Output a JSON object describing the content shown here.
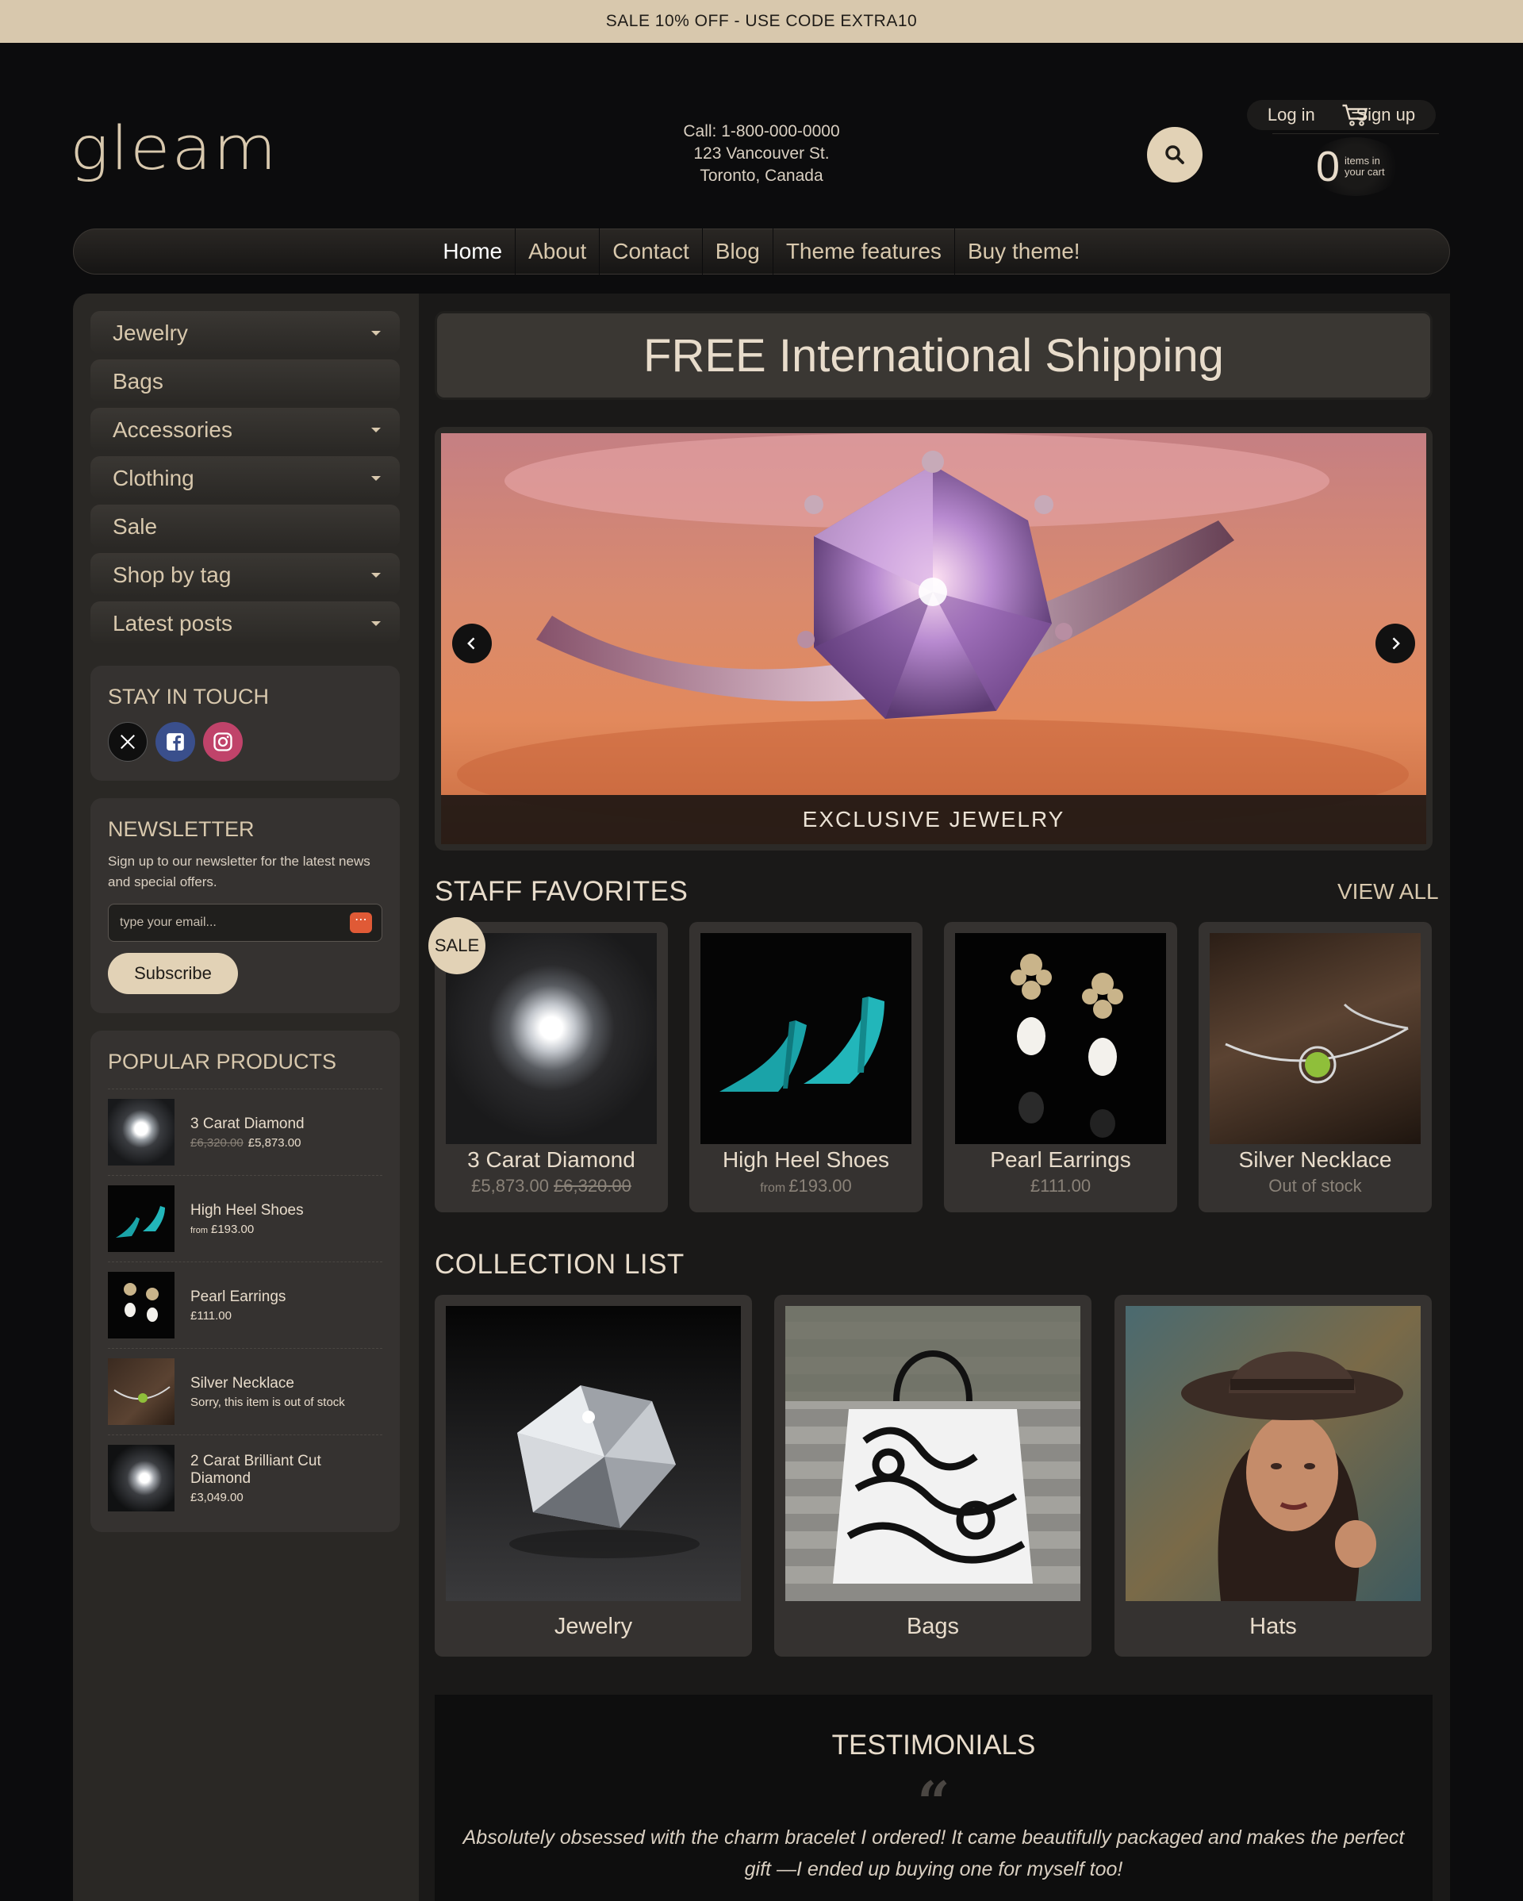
{
  "promo": {
    "text": "SALE 10% OFF - USE CODE EXTRA10"
  },
  "account": {
    "login": "Log in",
    "signup": "Sign up"
  },
  "logo": {
    "text": "gleam"
  },
  "contact": {
    "phone": "Call: 1-800-000-0000",
    "street": "123 Vancouver St.",
    "city": "Toronto, Canada"
  },
  "cart": {
    "count": "0",
    "label": "items in your cart"
  },
  "nav": {
    "items": [
      "Home",
      "About",
      "Contact",
      "Blog",
      "Theme features",
      "Buy theme!"
    ]
  },
  "sidebar": {
    "categories": [
      {
        "label": "Jewelry",
        "has_dropdown": true
      },
      {
        "label": "Bags",
        "has_dropdown": false
      },
      {
        "label": "Accessories",
        "has_dropdown": true
      },
      {
        "label": "Clothing",
        "has_dropdown": true
      },
      {
        "label": "Sale",
        "has_dropdown": false
      },
      {
        "label": "Shop by tag",
        "has_dropdown": true
      },
      {
        "label": "Latest posts",
        "has_dropdown": true
      }
    ],
    "stay_in_touch": {
      "title": "STAY IN TOUCH",
      "icons": [
        "x-icon",
        "facebook-icon",
        "instagram-icon"
      ]
    },
    "newsletter": {
      "title": "NEWSLETTER",
      "text": "Sign up to our newsletter for the latest news and special offers.",
      "placeholder": "type your email...",
      "button": "Subscribe"
    },
    "popular": {
      "title": "POPULAR PRODUCTS",
      "items": [
        {
          "name": "3 Carat Diamond",
          "old_price": "£6,320.00",
          "price": "£5,873.00",
          "from": ""
        },
        {
          "name": "High Heel Shoes",
          "old_price": "",
          "price": "£193.00",
          "from": "from"
        },
        {
          "name": "Pearl Earrings",
          "old_price": "",
          "price": "£111.00",
          "from": ""
        },
        {
          "name": "Silver Necklace",
          "old_price": "",
          "price": "Sorry, this item is out of stock",
          "from": ""
        },
        {
          "name": "2 Carat Brilliant Cut Diamond",
          "old_price": "",
          "price": "£3,049.00",
          "from": ""
        }
      ]
    }
  },
  "banner": {
    "text": "FREE International Shipping"
  },
  "slider": {
    "caption": "EXCLUSIVE JEWELRY"
  },
  "staff_favorites": {
    "title": "STAFF FAVORITES",
    "view_all": "VIEW ALL",
    "sale_badge": "SALE",
    "products": [
      {
        "name": "3 Carat Diamond",
        "price": "£5,873.00",
        "old_price": "£6,320.00",
        "from": ""
      },
      {
        "name": "High Heel Shoes",
        "price": "£193.00",
        "old_price": "",
        "from": "from"
      },
      {
        "name": "Pearl Earrings",
        "price": "£111.00",
        "old_price": "",
        "from": ""
      },
      {
        "name": "Silver Necklace",
        "price": "Out of stock",
        "old_price": "",
        "from": ""
      }
    ]
  },
  "collections": {
    "title": "COLLECTION LIST",
    "items": [
      {
        "name": "Jewelry"
      },
      {
        "name": "Bags"
      },
      {
        "name": "Hats"
      }
    ]
  },
  "testimonials": {
    "title": "TESTIMONIALS",
    "quote_mark": "“",
    "text": "Absolutely obsessed with the charm bracelet I ordered! It came beautifully packaged and makes the perfect gift —I ended up buying one for myself too!"
  }
}
